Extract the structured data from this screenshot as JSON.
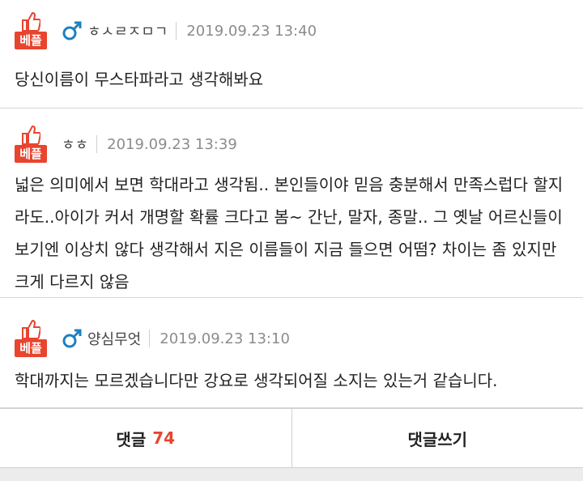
{
  "comments": [
    {
      "badge": "베플",
      "nickname": "ㅎㅅㄹㅈㅁㄱ",
      "show_gender_icon": true,
      "date": "2019.09.23 13:40",
      "text": "당신이름이 무스타파라고 생각해봐요"
    },
    {
      "badge": "베플",
      "nickname": "ㅎㅎ",
      "show_gender_icon": false,
      "date": "2019.09.23 13:39",
      "text": "넓은 의미에서 보면 학대라고 생각됨.. 본인들이야 믿음 충분해서 만족스럽다 할지라도..아이가 커서 개명할 확률 크다고 봄~ 간난, 말자, 종말.. 그 옛날 어르신들이 보기엔 이상치 않다 생각해서 지은 이름들이 지금 들으면 어떰? 차이는 좀 있지만 크게 다르지 않음"
    },
    {
      "badge": "베플",
      "nickname": "양심무엇",
      "show_gender_icon": true,
      "date": "2019.09.23 13:10",
      "text": "학대까지는 모르겠습니다만 강요로 생각되어질 소지는 있는거 같습니다."
    }
  ],
  "footer": {
    "comments_label": "댓글",
    "comments_count": "74",
    "write_label": "댓글쓰기"
  },
  "colors": {
    "accent": "#e8442e",
    "male_icon": "#1e7fc1"
  }
}
